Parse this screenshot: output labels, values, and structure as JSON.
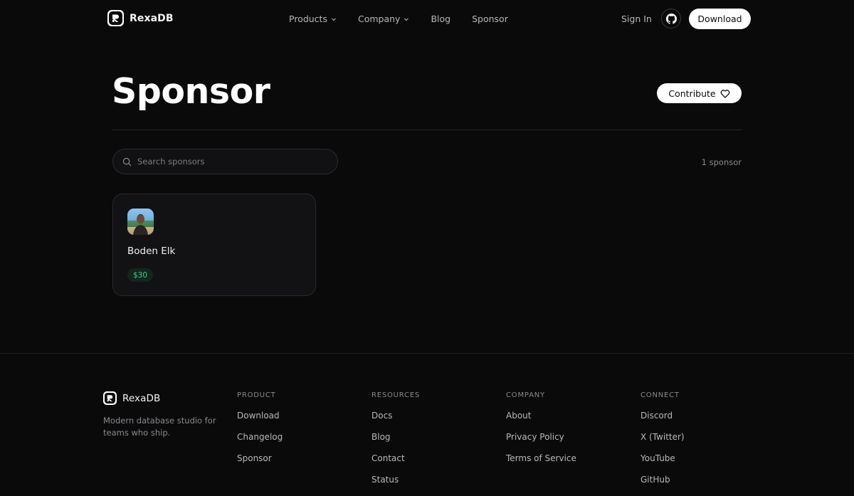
{
  "nav": {
    "brand": "RexaDB",
    "menu": [
      {
        "label": "Products",
        "has_dropdown": true
      },
      {
        "label": "Company",
        "has_dropdown": true
      },
      {
        "label": "Blog",
        "has_dropdown": false
      },
      {
        "label": "Sponsor",
        "has_dropdown": false
      }
    ],
    "sign_in": "Sign In",
    "github_icon": "github-icon",
    "download": "Download"
  },
  "header": {
    "title": "Sponsor",
    "contribute": "Contribute",
    "contribute_icon": "heart-icon"
  },
  "search": {
    "placeholder": "Search sponsors",
    "value": "",
    "icon": "search-icon"
  },
  "count_label": "1 sponsor",
  "sponsors": [
    {
      "name": "Boden Elk",
      "amount": "$30"
    }
  ],
  "footer": {
    "brand": "RexaDB",
    "tagline": "Modern database studio for teams who ship.",
    "columns": [
      {
        "heading": "PRODUCT",
        "links": [
          "Download",
          "Changelog",
          "Sponsor"
        ]
      },
      {
        "heading": "RESOURCES",
        "links": [
          "Docs",
          "Blog",
          "Contact",
          "Status"
        ]
      },
      {
        "heading": "COMPANY",
        "links": [
          "About",
          "Privacy Policy",
          "Terms of Service"
        ]
      },
      {
        "heading": "CONNECT",
        "links": [
          "Discord",
          "X (Twitter)",
          "YouTube",
          "GitHub"
        ]
      }
    ]
  },
  "colors": {
    "background": "#0a0a0b",
    "accent_green": "#3fcf8e",
    "button_bg": "#ffffff"
  }
}
